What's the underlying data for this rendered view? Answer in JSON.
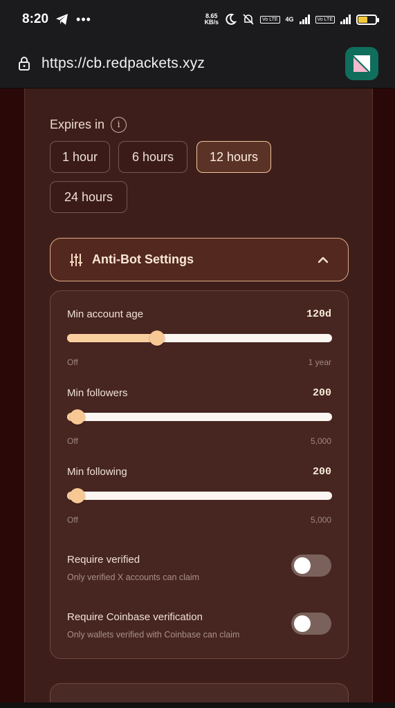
{
  "status_bar": {
    "time": "8:20",
    "net_speed_value": "8.65",
    "net_speed_unit": "KB/s",
    "sim1": "4G",
    "lte": "Vo LTE",
    "battery": "55"
  },
  "url_bar": {
    "url": "https://cb.redpackets.xyz"
  },
  "expires": {
    "label": "Expires in",
    "options": [
      "1 hour",
      "6 hours",
      "12 hours",
      "24 hours"
    ],
    "selected": "12 hours"
  },
  "antibot": {
    "title": "Anti-Bot Settings"
  },
  "sliders": [
    {
      "label": "Min account age",
      "value": "120d",
      "min": "Off",
      "max": "1 year",
      "fraction": 0.34
    },
    {
      "label": "Min followers",
      "value": "200",
      "min": "Off",
      "max": "5,000",
      "fraction": 0.04
    },
    {
      "label": "Min following",
      "value": "200",
      "min": "Off",
      "max": "5,000",
      "fraction": 0.04
    }
  ],
  "toggles": [
    {
      "label": "Require verified",
      "sub": "Only verified X accounts can claim",
      "on": false
    },
    {
      "label": "Require Coinbase verification",
      "sub": "Only wallets verified with Coinbase can claim",
      "on": false
    }
  ],
  "colors": {
    "accent": "#f8c894",
    "background": "#2a0808",
    "card": "#3e1e1a"
  }
}
